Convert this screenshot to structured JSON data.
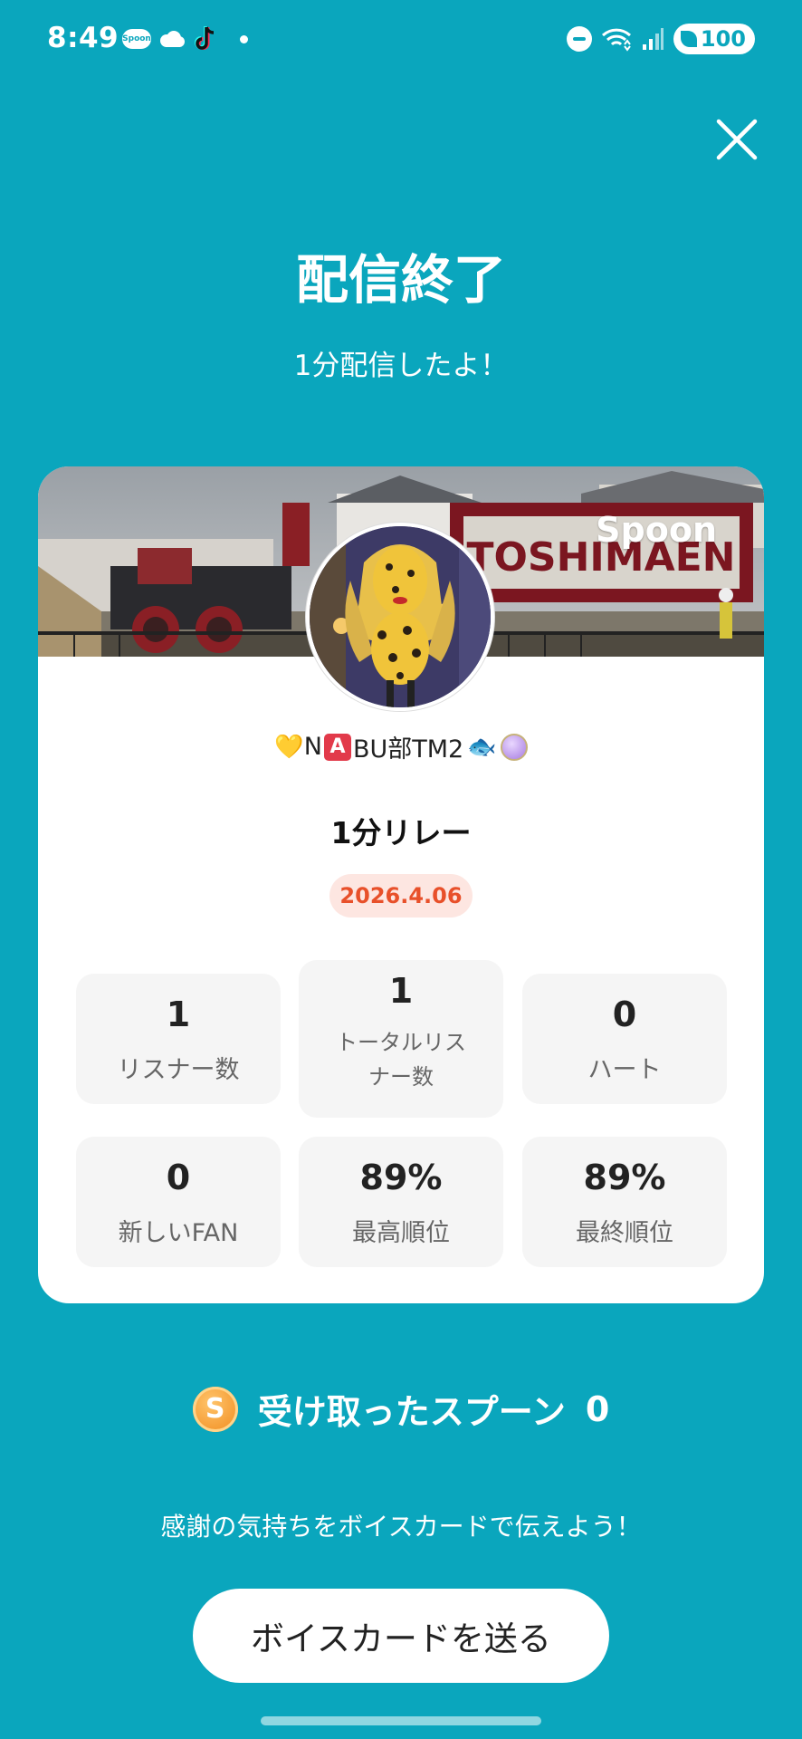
{
  "status_bar": {
    "time": "8:49",
    "spoon_app": "Spoon",
    "battery": "100"
  },
  "header": {
    "title": "配信終了",
    "subtitle": "1分配信したよ！"
  },
  "card": {
    "brand": "Spoon",
    "banner_sign": "TOSHIMAEN",
    "username": {
      "prefix_emoji": "💛",
      "part1": "N",
      "badge": "A",
      "part2": "BU部TM2",
      "suffix_emoji": "🐟"
    },
    "live_title": "1分リレー",
    "date": "2026.4.06",
    "stats": [
      {
        "value": "1",
        "label": "リスナー数"
      },
      {
        "value": "1",
        "label": "トータルリスナー数"
      },
      {
        "value": "0",
        "label": "ハート"
      },
      {
        "value": "0",
        "label": "新しいFAN"
      },
      {
        "value": "89%",
        "label": "最高順位"
      },
      {
        "value": "89%",
        "label": "最終順位"
      }
    ]
  },
  "spoons": {
    "coin_letter": "S",
    "label": "受け取ったスプーン",
    "count": "0"
  },
  "thanks_text": "感謝の気持ちをボイスカードで伝えよう！",
  "voice_button": "ボイスカードを送る",
  "colors": {
    "background": "#0aa6bd",
    "date_badge_text": "#e8502a",
    "date_badge_bg": "#fde6e1"
  }
}
